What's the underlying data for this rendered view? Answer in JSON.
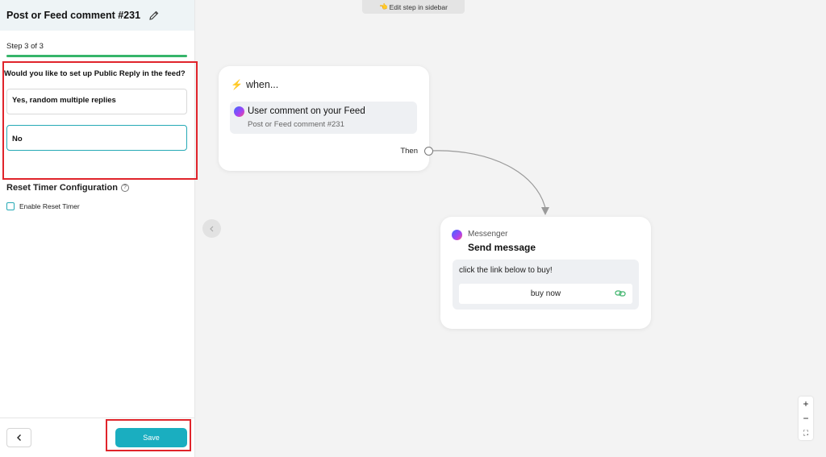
{
  "sidebar": {
    "title": "Post or Feed comment #231",
    "step_label": "Step 3 of 3",
    "progress": 1.0,
    "question": "Would you like to set up Public Reply in the feed?",
    "options": [
      {
        "label": "Yes, random multiple replies",
        "selected": false
      },
      {
        "label": "No",
        "selected": true
      }
    ],
    "reset_timer": {
      "title": "Reset Timer Configuration",
      "help_icon": "?",
      "checkbox_label": "Enable Reset Timer",
      "checked": false
    },
    "footer": {
      "back_icon": "chevron-left-icon",
      "save_label": "Save"
    }
  },
  "canvas": {
    "edit_hint": "Edit step in sidebar",
    "trigger": {
      "when_label": "when...",
      "title": "User comment on your Feed",
      "subtitle": "Post or Feed comment #231",
      "then_label": "Then"
    },
    "action": {
      "type": "Messenger",
      "title": "Send message",
      "message": "click the link below to buy!",
      "button_label": "buy now"
    },
    "zoom": {
      "in": "+",
      "out": "−",
      "fit": "⛶"
    }
  },
  "colors": {
    "accent": "#1aaec0",
    "progress": "#36b56a",
    "highlight": "#e0242b"
  }
}
